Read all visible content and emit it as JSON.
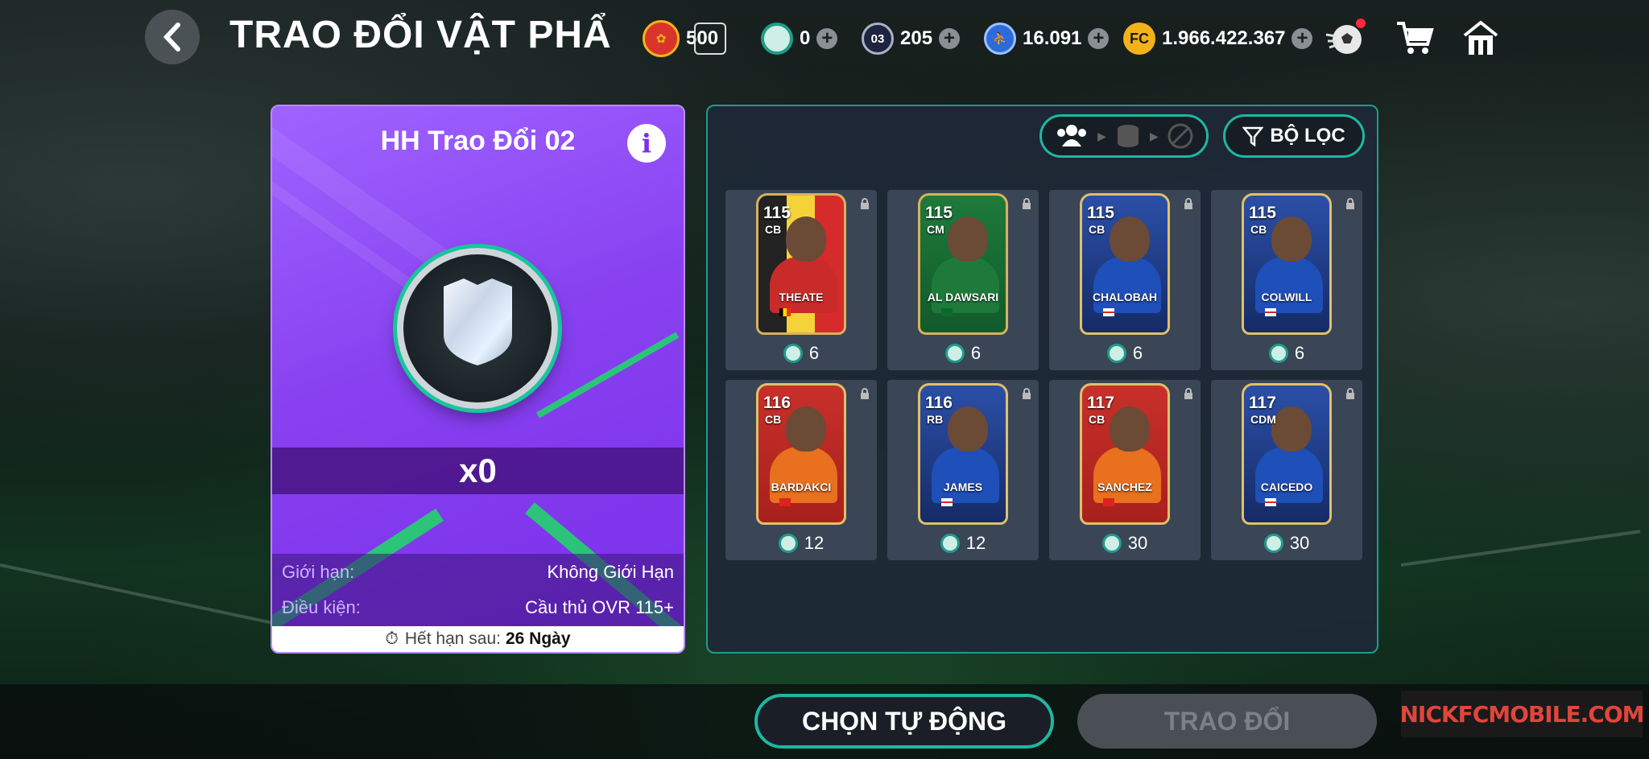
{
  "header": {
    "title": "TRAO ĐỔI VẬT PHẨ",
    "currencies": [
      {
        "icon": "event-badge-icon",
        "value": "500"
      },
      {
        "icon": "diamond-gem-icon",
        "value": "0"
      },
      {
        "icon": "ticket-03-icon",
        "value": "205"
      },
      {
        "icon": "player-token-icon",
        "value": "16.091"
      },
      {
        "icon": "fc-coin-icon",
        "value": "1.966.422.367"
      }
    ],
    "ticket_label": "03"
  },
  "left_panel": {
    "title": "HH Trao Đổi 02",
    "quantity": "x0",
    "limit_label": "Giới hạn:",
    "limit_value": "Không Giới Hạn",
    "condition_label": "Điều kiện:",
    "condition_value": "Cầu thủ OVR 115+",
    "expiry_label": "Hết hạn sau:",
    "expiry_value": "26 Ngày"
  },
  "right_panel": {
    "filter_label": "BỘ LỌC",
    "cards": [
      {
        "ovr": "115",
        "pos": "CB",
        "name": "THEATE",
        "cost": "6",
        "theme": "belgium"
      },
      {
        "ovr": "115",
        "pos": "CM",
        "name": "AL DAWSARI",
        "cost": "6",
        "theme": "saudi"
      },
      {
        "ovr": "115",
        "pos": "CB",
        "name": "CHALOBAH",
        "cost": "6",
        "theme": "chelsea"
      },
      {
        "ovr": "115",
        "pos": "CB",
        "name": "COLWILL",
        "cost": "6",
        "theme": "chelsea"
      },
      {
        "ovr": "116",
        "pos": "CB",
        "name": "BARDAKCI",
        "cost": "12",
        "theme": "galatasaray"
      },
      {
        "ovr": "116",
        "pos": "RB",
        "name": "JAMES",
        "cost": "12",
        "theme": "chelsea"
      },
      {
        "ovr": "117",
        "pos": "CB",
        "name": "SANCHEZ",
        "cost": "30",
        "theme": "galatasaray"
      },
      {
        "ovr": "117",
        "pos": "CDM",
        "name": "CAICEDO",
        "cost": "30",
        "theme": "chelsea"
      }
    ]
  },
  "footer": {
    "auto_select_label": "CHỌN TỰ ĐỘNG",
    "trade_label": "TRAO ĐỔI",
    "watermark": "NICKFCMOBILE.COM"
  },
  "colors": {
    "accent_teal": "#1fb7a2",
    "panel_purple": "#8840f0",
    "card_gold": "#d7b25b",
    "coin_gold": "#f3b21a"
  }
}
